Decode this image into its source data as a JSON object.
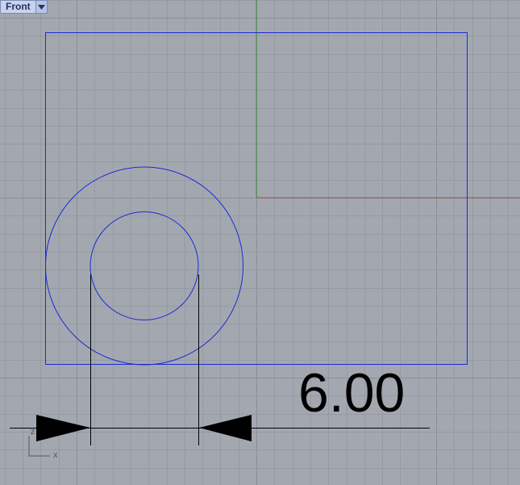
{
  "viewport": {
    "name": "Front",
    "menu_icon": "triangle-down-icon"
  },
  "dimension": {
    "value_text": "6.00"
  },
  "axis_widget": {
    "x_label": "x",
    "z_label": "z"
  },
  "colors": {
    "background": "#a3a8b0",
    "grid_minor": "#969ba3",
    "grid_major": "#8a8f97",
    "x_axis": "#b5444a",
    "y_axis": "#3c8a3c",
    "geometry": "#1a2bd6",
    "dimension": "#000000"
  }
}
